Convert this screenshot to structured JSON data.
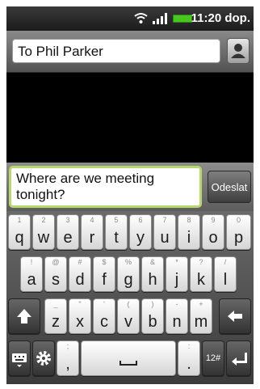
{
  "status_bar": {
    "time": "11:20 dop."
  },
  "recipient": {
    "value": "To Phil Parker"
  },
  "compose": {
    "message": "Where are we meeting tonight?",
    "send_label": "Odeslat"
  },
  "keyboard": {
    "row1": [
      {
        "pri": "q",
        "sec": "1"
      },
      {
        "pri": "w",
        "sec": "2"
      },
      {
        "pri": "e",
        "sec": "3"
      },
      {
        "pri": "r",
        "sec": "4"
      },
      {
        "pri": "t",
        "sec": "5"
      },
      {
        "pri": "y",
        "sec": "6"
      },
      {
        "pri": "u",
        "sec": "7"
      },
      {
        "pri": "i",
        "sec": "8"
      },
      {
        "pri": "o",
        "sec": "9"
      },
      {
        "pri": "p",
        "sec": "0"
      }
    ],
    "row2": [
      {
        "pri": "a",
        "sec": "!"
      },
      {
        "pri": "s",
        "sec": "@"
      },
      {
        "pri": "d",
        "sec": "#"
      },
      {
        "pri": "f",
        "sec": "$"
      },
      {
        "pri": "g",
        "sec": "%"
      },
      {
        "pri": "h",
        "sec": "&"
      },
      {
        "pri": "j",
        "sec": "*"
      },
      {
        "pri": "k",
        "sec": "?"
      },
      {
        "pri": "l",
        "sec": "/"
      }
    ],
    "row3": [
      {
        "pri": "z",
        "sec": "_"
      },
      {
        "pri": "x",
        "sec": "\""
      },
      {
        "pri": "c",
        "sec": "'"
      },
      {
        "pri": "v",
        "sec": "("
      },
      {
        "pri": "b",
        "sec": ")"
      },
      {
        "pri": "n",
        "sec": "-"
      },
      {
        "pri": "m",
        "sec": "+"
      }
    ],
    "comma": {
      "pri": ",",
      "sec": ";"
    },
    "period": {
      "pri": ".",
      "sec": ":"
    },
    "symbols_label": "12#"
  }
}
